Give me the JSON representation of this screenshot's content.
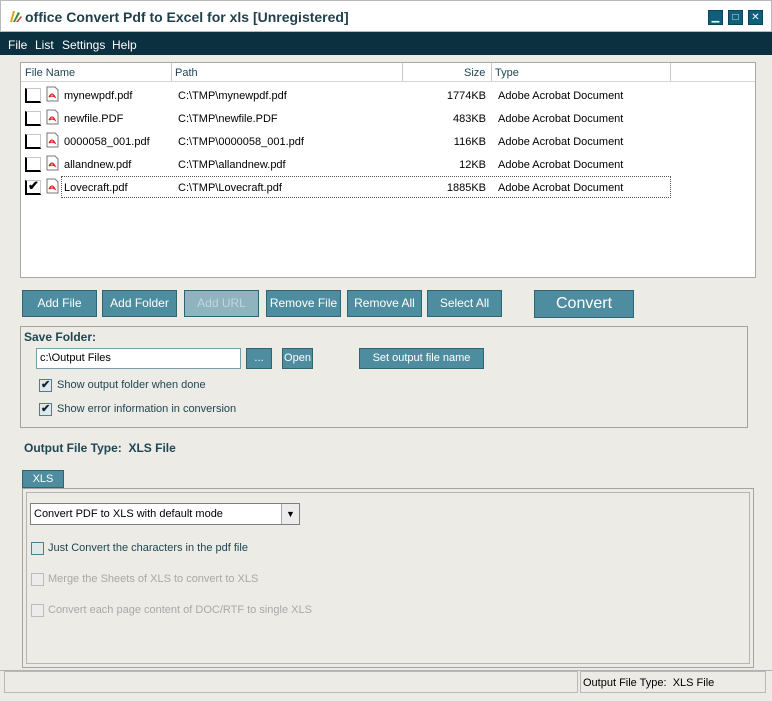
{
  "window": {
    "title": "office Convert Pdf to Excel for xls [Unregistered]",
    "controls": [
      "minimize-icon",
      "maximize-icon",
      "close-icon"
    ]
  },
  "menu": {
    "items": [
      {
        "label": "File"
      },
      {
        "label": "List"
      },
      {
        "label": "Settings"
      },
      {
        "label": "Help"
      }
    ]
  },
  "filelist": {
    "headers": {
      "name": "File Name",
      "path": "Path",
      "size": "Size",
      "type": "Type"
    },
    "rows": [
      {
        "checked": false,
        "name": "mynewpdf.pdf",
        "path": "C:\\TMP\\mynewpdf.pdf",
        "size": "1774KB",
        "type": "Adobe Acrobat Document"
      },
      {
        "checked": false,
        "name": "newfile.PDF",
        "path": "C:\\TMP\\newfile.PDF",
        "size": "483KB",
        "type": "Adobe Acrobat Document"
      },
      {
        "checked": false,
        "name": "0000058_001.pdf",
        "path": "C:\\TMP\\0000058_001.pdf",
        "size": "116KB",
        "type": "Adobe Acrobat Document"
      },
      {
        "checked": false,
        "name": "allandnew.pdf",
        "path": "C:\\TMP\\allandnew.pdf",
        "size": "12KB",
        "type": "Adobe Acrobat Document"
      },
      {
        "checked": true,
        "name": "Lovecraft.pdf",
        "path": "C:\\TMP\\Lovecraft.pdf",
        "size": "1885KB",
        "type": "Adobe Acrobat Document"
      }
    ]
  },
  "toolbar": {
    "add_file": "Add File",
    "add_folder": "Add Folder",
    "add_url": "Add URL",
    "remove_file": "Remove File",
    "remove_all": "Remove All",
    "select_all": "Select All",
    "convert": "Convert"
  },
  "save_folder": {
    "title": "Save Folder:",
    "path_value": "c:\\Output Files",
    "browse_label": "...",
    "open_label": "Open",
    "set_name_label": "Set output file name",
    "show_output_folder_label": "Show output folder when done",
    "show_output_folder_checked": true,
    "show_error_label": "Show error information in conversion",
    "show_error_checked": true
  },
  "output_type": {
    "label": "Output File Type:",
    "value": "XLS File"
  },
  "xls_tab": {
    "tab_label": "XLS",
    "mode_selected": "Convert PDF to XLS with default mode",
    "opt_characters_label": "Just Convert the characters in the pdf file",
    "opt_characters_checked": false,
    "opt_merge_label": "Merge the Sheets of XLS to convert to XLS",
    "opt_merge_enabled": false,
    "opt_each_page_label": "Convert each page content of DOC/RTF to single XLS",
    "opt_each_page_enabled": false
  },
  "statusbar": {
    "left_text": "",
    "output_type_label": "Output File Type:",
    "output_type_value": "XLS File"
  },
  "colors": {
    "title_text": "#1f3f4a",
    "menubar_bg": "#0b3040",
    "button_bg": "#4e8da0",
    "label_text": "#1e4653"
  }
}
